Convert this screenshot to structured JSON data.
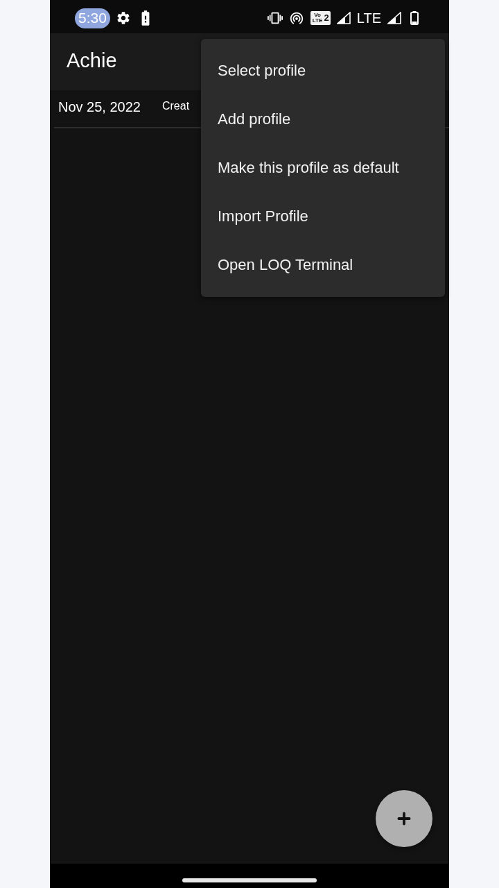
{
  "status_bar": {
    "time": "5:30",
    "volte": {
      "label": "Vo LTE",
      "sim": "2"
    },
    "network": "LTE"
  },
  "app_bar": {
    "title": "Achie"
  },
  "entries": [
    {
      "date": "Nov 25, 2022",
      "text": "Creat"
    }
  ],
  "menu": {
    "items": [
      "Select profile",
      "Add profile",
      "Make this profile as default",
      "Import Profile",
      "Open LOQ Terminal"
    ]
  }
}
